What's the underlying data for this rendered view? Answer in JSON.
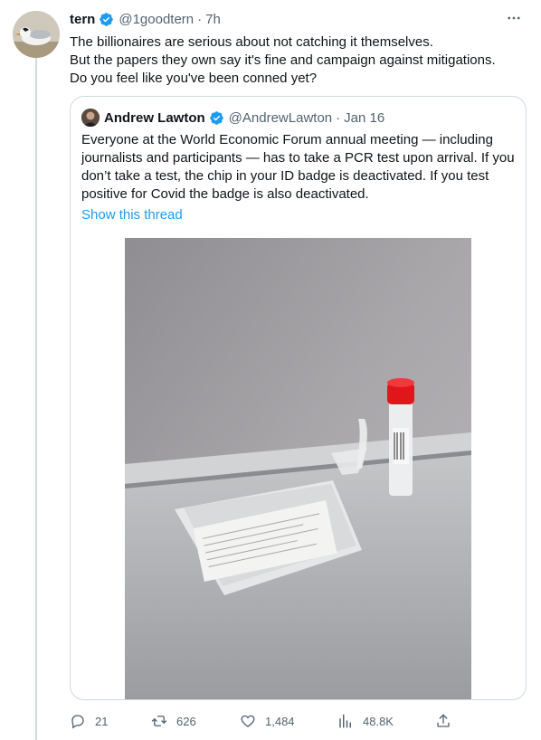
{
  "tweet": {
    "author_name": "tern",
    "author_handle": "@1goodtern",
    "time": "7h",
    "separator": "·",
    "text_lines": [
      "The billionaires are serious about not catching it themselves.",
      "But the papers they own say it's fine and campaign against mitigations.",
      "Do you feel like you've been conned yet?"
    ]
  },
  "quoted": {
    "author_name": "Andrew Lawton",
    "author_handle": "@AndrewLawton",
    "time": "Jan 16",
    "separator": "·",
    "text_lines": [
      "Everyone at the World Economic Forum annual meeting — including",
      "journalists and participants — has to take a PCR test upon arrival. If you",
      "don’t take a test, the chip in your ID badge is deactivated. If you test",
      "positive for Covid the badge is also deactivated."
    ],
    "show_thread": "Show this thread"
  },
  "actions": {
    "replies": "21",
    "retweets": "626",
    "likes": "1,484",
    "views": "48.8K"
  },
  "colors": {
    "accent": "#1d9bf0",
    "muted": "#536471",
    "border": "#cfd9de",
    "text": "#0f1419"
  },
  "icons": {
    "verified": "verified-badge-icon",
    "more": "more-options-icon",
    "reply": "reply-icon",
    "retweet": "retweet-icon",
    "like": "heart-icon",
    "views": "views-icon",
    "share": "share-icon"
  }
}
